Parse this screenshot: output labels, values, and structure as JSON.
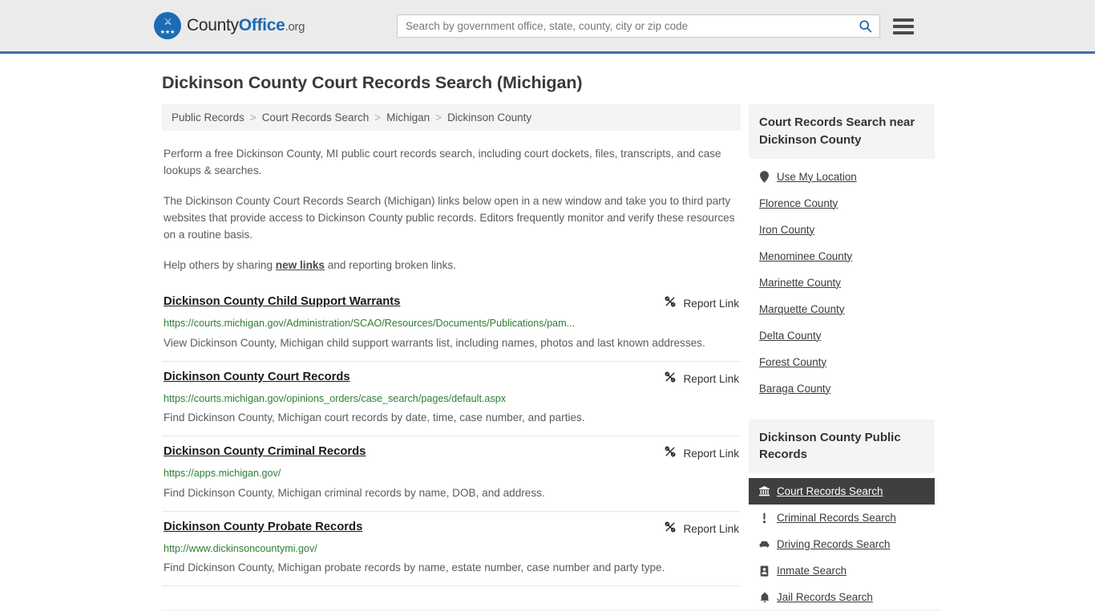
{
  "header": {
    "logo": {
      "prefix": "County",
      "bold": "Office",
      "suffix": ".org",
      "icon": "eagle-shield-logo"
    },
    "search": {
      "placeholder": "Search by government office, state, county, city or zip code",
      "value": "",
      "icon": "search-icon"
    },
    "menu_icon": "hamburger-menu-icon"
  },
  "page": {
    "title": "Dickinson County Court Records Search (Michigan)"
  },
  "breadcrumb": {
    "separator": ">",
    "items": [
      {
        "label": "Public Records"
      },
      {
        "label": "Court Records Search"
      },
      {
        "label": "Michigan"
      },
      {
        "label": "Dickinson County"
      }
    ]
  },
  "intro": {
    "p1": "Perform a free Dickinson County, MI public court records search, including court dockets, files, transcripts, and case lookups & searches.",
    "p2": "The Dickinson County Court Records Search (Michigan) links below open in a new window and take you to third party websites that provide access to Dickinson County public records. Editors frequently monitor and verify these resources on a routine basis.",
    "p3_before": "Help others by sharing ",
    "p3_link": "new links",
    "p3_after": " and reporting broken links."
  },
  "results": {
    "report_label": "Report Link",
    "report_icon": "broken-link-icon",
    "items": [
      {
        "title": "Dickinson County Child Support Warrants",
        "url": "https://courts.michigan.gov/Administration/SCAO/Resources/Documents/Publications/pam...",
        "description": "View Dickinson County, Michigan child support warrants list, including names, photos and last known addresses."
      },
      {
        "title": "Dickinson County Court Records",
        "url": "https://courts.michigan.gov/opinions_orders/case_search/pages/default.aspx",
        "description": "Find Dickinson County, Michigan court records by date, time, case number, and parties."
      },
      {
        "title": "Dickinson County Criminal Records",
        "url": "https://apps.michigan.gov/",
        "description": "Find Dickinson County, Michigan criminal records by name, DOB, and address."
      },
      {
        "title": "Dickinson County Probate Records",
        "url": "http://www.dickinsoncountymi.gov/",
        "description": "Find Dickinson County, Michigan probate records by name, estate number, case number and party type."
      }
    ]
  },
  "sidebar": {
    "nearby": {
      "title": "Court Records Search near Dickinson County",
      "items": [
        {
          "label": "Use My Location",
          "icon": "map-pin-icon"
        },
        {
          "label": "Florence County",
          "icon": ""
        },
        {
          "label": "Iron County",
          "icon": ""
        },
        {
          "label": "Menominee County",
          "icon": ""
        },
        {
          "label": "Marinette County",
          "icon": ""
        },
        {
          "label": "Marquette County",
          "icon": ""
        },
        {
          "label": "Delta County",
          "icon": ""
        },
        {
          "label": "Forest County",
          "icon": ""
        },
        {
          "label": "Baraga County",
          "icon": ""
        }
      ]
    },
    "public_records": {
      "title": "Dickinson County Public Records",
      "items": [
        {
          "label": "Court Records Search",
          "icon": "bank-building-icon",
          "active": true
        },
        {
          "label": "Criminal Records Search",
          "icon": "exclamation-icon",
          "active": false
        },
        {
          "label": "Driving Records Search",
          "icon": "car-icon",
          "active": false
        },
        {
          "label": "Inmate Search",
          "icon": "id-badge-icon",
          "active": false
        },
        {
          "label": "Jail Records Search",
          "icon": "bell-icon",
          "active": false
        }
      ]
    }
  },
  "colors": {
    "header_bg": "#ebebeb",
    "header_border": "#3d6fa5",
    "brand_blue": "#1b6cb5",
    "url_green": "#2f7d32",
    "active_bg": "#3f3f3f",
    "panel_bg": "#f4f4f4"
  }
}
